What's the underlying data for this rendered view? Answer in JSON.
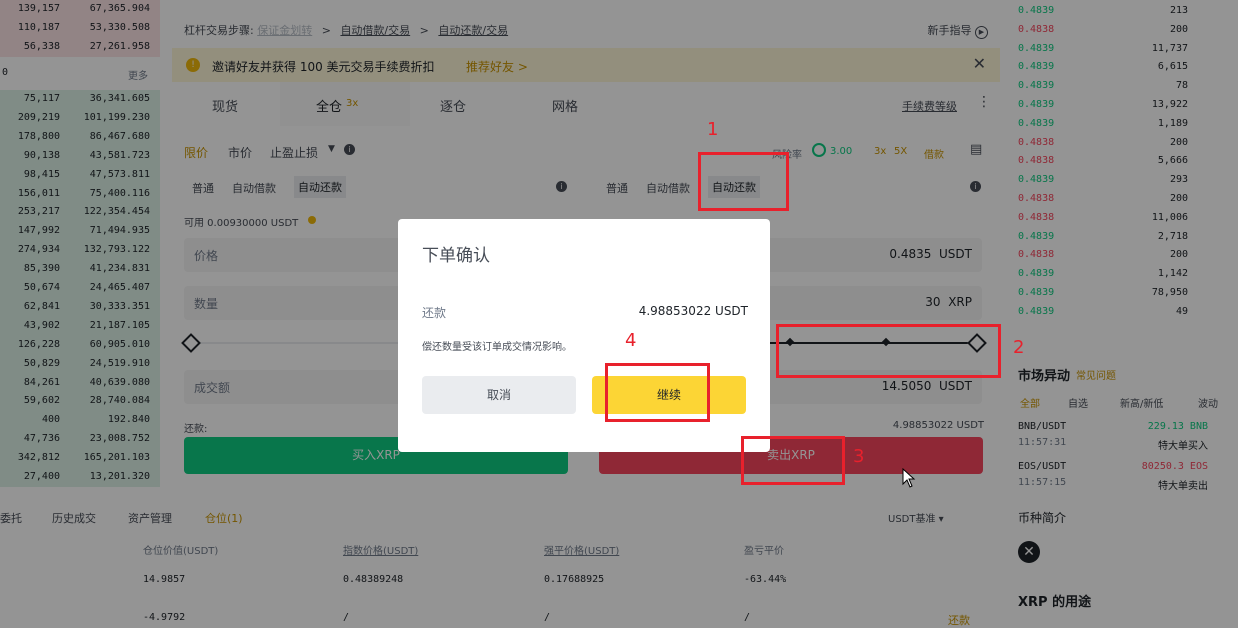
{
  "left_book": {
    "sells": [
      [
        "139,157",
        "67,365.904"
      ],
      [
        "110,187",
        "53,330.508"
      ],
      [
        "56,338",
        "27,261.958"
      ]
    ],
    "mid": {
      "left": "0",
      "more": "更多"
    },
    "buys": [
      [
        "75,117",
        "36,341.605"
      ],
      [
        "209,219",
        "101,199.230"
      ],
      [
        "178,800",
        "86,467.680"
      ],
      [
        "90,138",
        "43,581.723"
      ],
      [
        "98,415",
        "47,573.811"
      ],
      [
        "156,011",
        "75,400.116"
      ],
      [
        "253,217",
        "122,354.454"
      ],
      [
        "147,992",
        "71,494.935"
      ],
      [
        "274,934",
        "132,793.122"
      ],
      [
        "85,390",
        "41,234.831"
      ],
      [
        "50,674",
        "24,465.407"
      ],
      [
        "62,841",
        "30,333.351"
      ],
      [
        "43,902",
        "21,187.105"
      ],
      [
        "126,228",
        "60,905.010"
      ],
      [
        "50,829",
        "24,519.910"
      ],
      [
        "84,261",
        "40,639.080"
      ],
      [
        "59,602",
        "28,740.084"
      ],
      [
        "400",
        "192.840"
      ],
      [
        "47,736",
        "23,008.752"
      ],
      [
        "342,812",
        "165,201.103"
      ],
      [
        "27,400",
        "13,201.320"
      ]
    ]
  },
  "breadcrumb": {
    "items": [
      "杠杆交易步骤:",
      "保证金划转",
      ">",
      "自动借款/交易",
      ">",
      "自动还款/交易"
    ],
    "guide": "新手指导"
  },
  "banner": {
    "text": "邀请好友并获得 100 美元交易手续费折扣",
    "link": "推荐好友 >"
  },
  "mode_tabs": [
    "现货",
    "全仓",
    "3x",
    "逐仓",
    "网格"
  ],
  "fee_link": "手续费等级",
  "order_types": {
    "limit": "限价",
    "market": "市价",
    "stop": "止盈止损"
  },
  "risk": {
    "label": "风险率",
    "value": "3.00",
    "lev": "3x",
    "lev_label": "5X",
    "borrow": "借款"
  },
  "sub_tabs_left": [
    "普通",
    "自动借款",
    "自动还款"
  ],
  "sub_tabs_right": [
    "普通",
    "自动借款",
    "自动还款"
  ],
  "available": "可用  0.00930000 USDT",
  "price_field": {
    "label": "价格",
    "value": "0.4835",
    "unit": "USDT"
  },
  "qty_field": {
    "label": "数量",
    "value": "30",
    "unit": "XRP"
  },
  "total_field": {
    "label": "成交额",
    "value": "14.5050",
    "unit": "USDT"
  },
  "repay_row": {
    "label": "还款:",
    "value": "4.98853022 USDT"
  },
  "buy_btn": "买入XRP",
  "sell_btn": "卖出XRP",
  "right_book": [
    [
      "0.4839",
      "213",
      "g"
    ],
    [
      "0.4838",
      "200",
      "r"
    ],
    [
      "0.4839",
      "11,737",
      "g"
    ],
    [
      "0.4839",
      "6,615",
      "g"
    ],
    [
      "0.4839",
      "78",
      "g"
    ],
    [
      "0.4839",
      "13,922",
      "g"
    ],
    [
      "0.4839",
      "1,189",
      "g"
    ],
    [
      "0.4838",
      "200",
      "r"
    ],
    [
      "0.4838",
      "5,666",
      "r"
    ],
    [
      "0.4839",
      "293",
      "g"
    ],
    [
      "0.4838",
      "200",
      "r"
    ],
    [
      "0.4838",
      "11,006",
      "r"
    ],
    [
      "0.4839",
      "2,718",
      "g"
    ],
    [
      "0.4838",
      "200",
      "r"
    ],
    [
      "0.4839",
      "1,142",
      "g"
    ],
    [
      "0.4839",
      "78,950",
      "g"
    ],
    [
      "0.4839",
      "49",
      "g"
    ]
  ],
  "market_moves": {
    "title": "市场异动",
    "link": "常见问题",
    "tabs": [
      "全部",
      "自选",
      "新高/新低",
      "波动"
    ],
    "items": [
      {
        "pair": "BNB/USDT",
        "time": "11:57:31",
        "val": "229.13 BNB",
        "desc": "特大单买入"
      },
      {
        "pair": "EOS/USDT",
        "time": "11:57:15",
        "val": "80250.3 EOS",
        "desc": "特大单卖出"
      }
    ]
  },
  "coin_info": {
    "title": "币种简介",
    "section": "XRP 的用途"
  },
  "bottom": {
    "tabs": [
      "委托",
      "历史成交",
      "资产管理",
      "仓位(1)"
    ],
    "filter": "USDT基准",
    "headers": [
      "仓位价值(USDT)",
      "指数价格(USDT)",
      "强平价格(USDT)",
      "盈亏平价"
    ],
    "rows": [
      [
        "14.9857",
        "0.48389248",
        "0.17688925",
        "-63.44%"
      ],
      [
        "-4.9792",
        "/",
        "/",
        "/"
      ]
    ],
    "repay": "还款"
  },
  "dialog": {
    "title": "下单确认",
    "repay_label": "还款",
    "repay_value": "4.98853022 USDT",
    "note": "偿还数量受该订单成交情况影响。",
    "cancel": "取消",
    "confirm": "继续"
  },
  "annotations": [
    "1",
    "2",
    "3",
    "4"
  ],
  "colors": {
    "accent": "#fcd535",
    "buy": "#0ecb81",
    "sell": "#f6465d",
    "annotation": "#e8212c"
  }
}
